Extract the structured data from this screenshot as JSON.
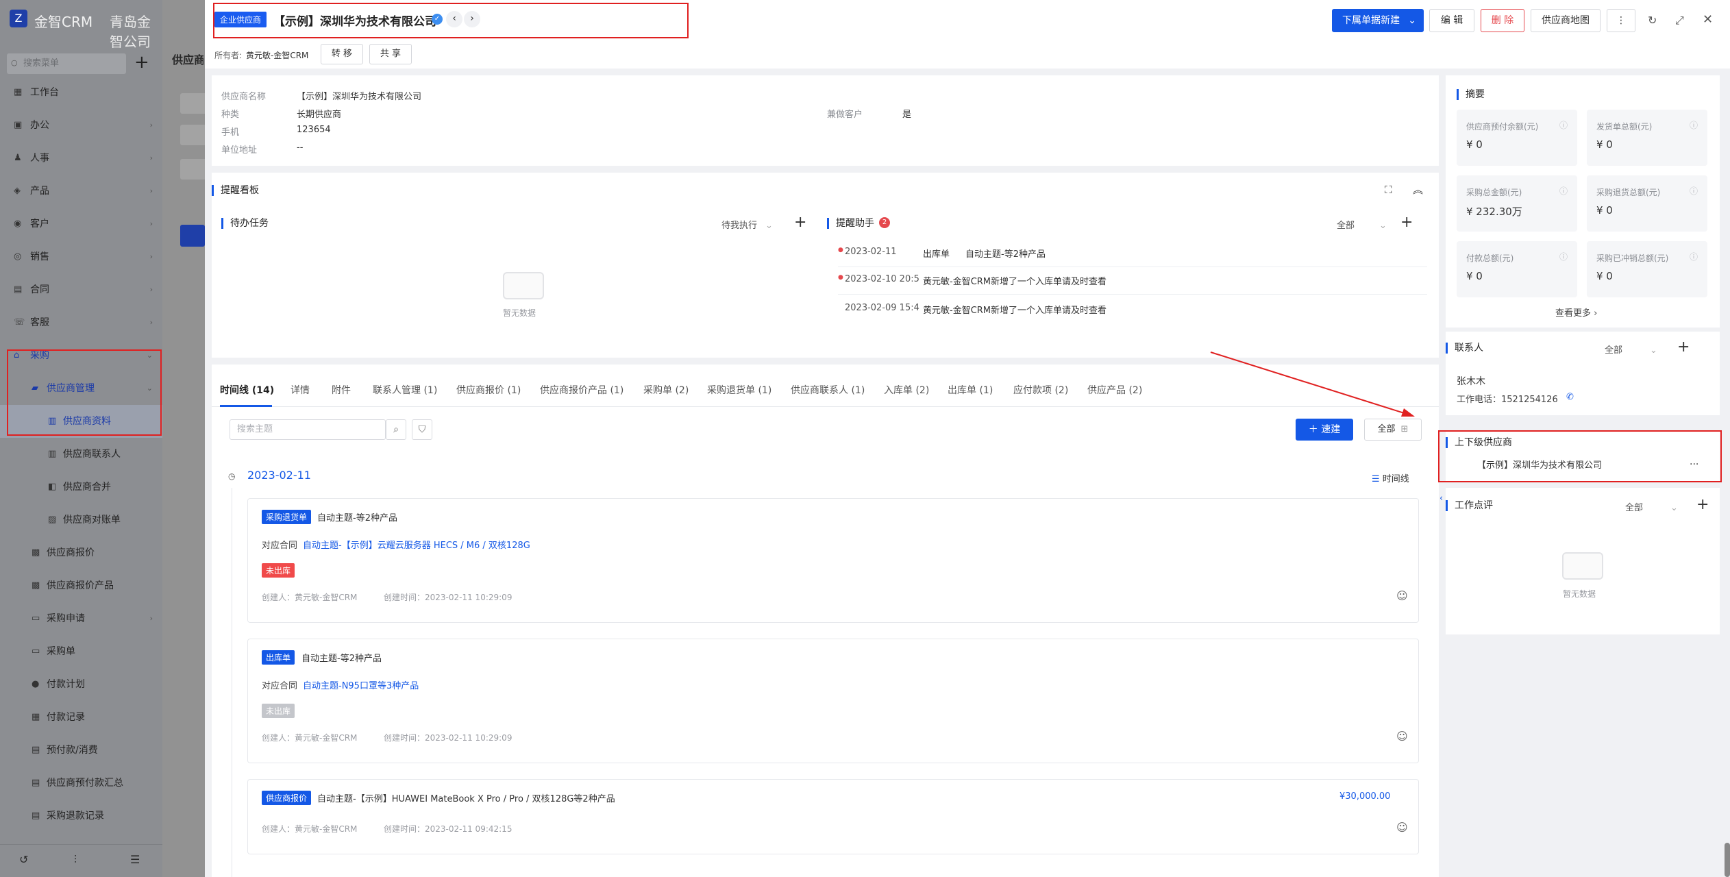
{
  "sidebar": {
    "brand": "金智CRM",
    "company": "青岛金智公司",
    "search_placeholder": "搜索菜单",
    "menu": [
      {
        "label": "工作台",
        "icon": "dashboard-icon"
      },
      {
        "label": "办公",
        "icon": "office-icon"
      },
      {
        "label": "人事",
        "icon": "people-icon"
      },
      {
        "label": "产品",
        "icon": "box-icon"
      },
      {
        "label": "客户",
        "icon": "customer-icon"
      },
      {
        "label": "销售",
        "icon": "sales-icon"
      },
      {
        "label": "合同",
        "icon": "contract-icon"
      },
      {
        "label": "客服",
        "icon": "service-icon"
      },
      {
        "label": "采购",
        "icon": "purchase-icon"
      },
      {
        "label": "供应商管理",
        "icon": "folder-icon"
      },
      {
        "label": "供应商资料",
        "icon": "doc-icon"
      },
      {
        "label": "供应商联系人",
        "icon": "contact-icon"
      },
      {
        "label": "供应商合并",
        "icon": "merge-icon"
      },
      {
        "label": "供应商对账单",
        "icon": "statement-icon"
      },
      {
        "label": "供应商报价",
        "icon": "quote-icon"
      },
      {
        "label": "供应商报价产品",
        "icon": "quote-product-icon"
      },
      {
        "label": "采购申请",
        "icon": "request-icon"
      },
      {
        "label": "采购单",
        "icon": "order-icon"
      },
      {
        "label": "付款计划",
        "icon": "plan-icon"
      },
      {
        "label": "付款记录",
        "icon": "record-icon"
      },
      {
        "label": "预付款/消费",
        "icon": "prepay-icon"
      },
      {
        "label": "供应商预付款汇总",
        "icon": "summary-icon"
      },
      {
        "label": "采购退款记录",
        "icon": "refund-icon"
      }
    ]
  },
  "behind": {
    "title": "供应商"
  },
  "header": {
    "type_tag": "企业供应商",
    "title": "【示例】深圳华为技术有限公司",
    "owner_label": "所有者:",
    "owner": "黄元敏-金智CRM",
    "transfer": "转 移",
    "share": "共 享",
    "new_sub": "下属单据新建",
    "edit": "编 辑",
    "delete": "删 除",
    "map": "供应商地图"
  },
  "info": {
    "name_label": "供应商名称",
    "name": "【示例】深圳华为技术有限公司",
    "type_label": "种类",
    "type": "长期供应商",
    "also_customer_label": "兼做客户",
    "also_customer": "是",
    "phone_label": "手机",
    "phone": "123654",
    "address_label": "单位地址",
    "address": "--"
  },
  "reminder": {
    "board_title": "提醒看板",
    "todo_title": "待办任务",
    "todo_filter": "待我执行",
    "empty": "暂无数据",
    "assistant_title": "提醒助手",
    "assistant_count": "2",
    "assistant_filter": "全部",
    "items": [
      {
        "time": "2023-02-11",
        "type": "出库单",
        "text": "自动主题-等2种产品"
      },
      {
        "time": "2023-02-10 20:5",
        "type": "",
        "text": "黄元敏-金智CRM新增了一个入库单请及时查看"
      },
      {
        "time": "2023-02-09 15:4",
        "type": "",
        "text": "黄元敏-金智CRM新增了一个入库单请及时查看"
      }
    ]
  },
  "tabs": [
    "时间线 (14)",
    "详情",
    "附件",
    "联系人管理 (1)",
    "供应商报价 (1)",
    "供应商报价产品 (1)",
    "采购单 (2)",
    "采购退货单 (1)",
    "供应商联系人 (1)",
    "入库单 (2)",
    "出库单 (1)",
    "应付款项 (2)",
    "供应产品 (2)"
  ],
  "timeline": {
    "search_placeholder": "搜索主题",
    "quick_create": "速建",
    "all_label": "全部",
    "date": "2023-02-11",
    "view_label": "时间线",
    "entries": [
      {
        "tag": "采购退货单",
        "subject": "自动主题-等2种产品",
        "contract_label": "对应合同",
        "contract": "自动主题-【示例】云耀云服务器 HECS / M6 / 双核128G",
        "status": "未出库",
        "creator": "创建人：黄元敏-金智CRM",
        "created": "创建时间：2023-02-11 10:29:09"
      },
      {
        "tag": "出库单",
        "subject": "自动主题-等2种产品",
        "contract_label": "对应合同",
        "contract": "自动主题-N95口罩等3种产品",
        "status": "未出库",
        "creator": "创建人：黄元敏-金智CRM",
        "created": "创建时间：2023-02-11 10:29:09"
      },
      {
        "tag": "供应商报价",
        "subject": "自动主题-【示例】HUAWEI MateBook X Pro / Pro / 双核128G等2种产品",
        "amount": "¥30,000.00",
        "creator": "创建人：黄元敏-金智CRM",
        "created": "创建时间：2023-02-11 09:42:15"
      }
    ]
  },
  "summary": {
    "title": "摘要",
    "items": [
      {
        "label": "供应商预付余额(元)",
        "value": "¥ 0"
      },
      {
        "label": "发货单总额(元)",
        "value": "¥ 0"
      },
      {
        "label": "采购总金额(元)",
        "value": "¥ 232.30万"
      },
      {
        "label": "采购退货总额(元)",
        "value": "¥ 0"
      },
      {
        "label": "付款总额(元)",
        "value": "¥ 0"
      },
      {
        "label": "采购已冲销总额(元)",
        "value": "¥ 0"
      }
    ],
    "more": "查看更多"
  },
  "contacts": {
    "title": "联系人",
    "filter": "全部",
    "name": "张木木",
    "phone": "工作电话：1521254126"
  },
  "parent": {
    "title": "上下级供应商",
    "item": "【示例】深圳华为技术有限公司",
    "more": "..."
  },
  "review": {
    "title": "工作点评",
    "filter": "全部",
    "empty": "暂无数据"
  },
  "colors": {
    "accent": "#1458e6",
    "danger": "#e5484d",
    "annotation": "#e02020"
  }
}
